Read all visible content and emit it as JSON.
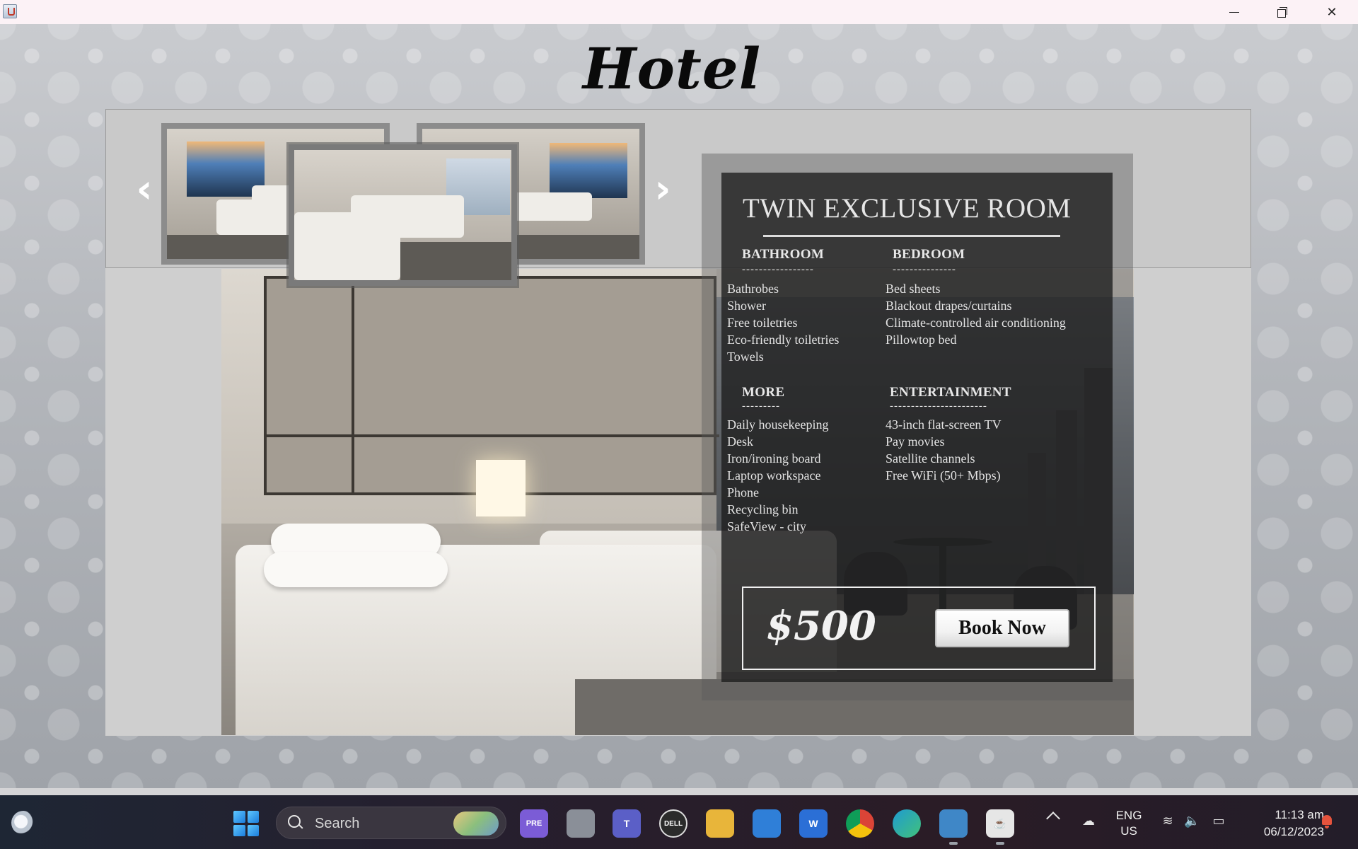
{
  "window": {
    "controls": {
      "minimize": "minimize",
      "maximize": "restore",
      "close": "close"
    }
  },
  "app": {
    "title": "Hotel"
  },
  "gallery": {
    "prev_icon": "chevron-left-icon",
    "next_icon": "chevron-right-icon",
    "prev_glyph": "‹",
    "next_glyph": "›"
  },
  "room": {
    "name": "TWIN EXCLUSIVE ROOM",
    "sections": {
      "bathroom": {
        "heading": "BATHROOM",
        "underline": "-----------------",
        "items": [
          "Bathrobes",
          "Shower",
          "Free toiletries",
          "Eco-friendly toiletries",
          "Towels"
        ]
      },
      "bedroom": {
        "heading": "BEDROOM",
        "underline": "---------------",
        "items": [
          "Bed sheets",
          "Blackout drapes/curtains",
          "Climate-controlled air conditioning",
          "Pillowtop bed"
        ]
      },
      "more": {
        "heading": "MORE",
        "underline": "---------",
        "items": [
          "Daily housekeeping",
          "Desk",
          "Iron/ironing board",
          "Laptop workspace",
          "Phone",
          "Recycling bin",
          "SafeView - city"
        ]
      },
      "entertainment": {
        "heading": "ENTERTAINMENT",
        "underline": "-----------------------",
        "items": [
          "43-inch flat-screen TV",
          "Pay movies",
          "Satellite channels",
          "Free WiFi (50+ Mbps)"
        ]
      }
    },
    "price": "$500",
    "book_label": "Book Now"
  },
  "taskbar": {
    "search_label": "Search",
    "apps": [
      {
        "name": "copilot-icon",
        "label": "PRE",
        "color": "#7b5cd6"
      },
      {
        "name": "task-view-icon",
        "label": "",
        "color": "#8a8f98"
      },
      {
        "name": "teams-icon",
        "label": "T",
        "color": "#5b5fc7"
      },
      {
        "name": "dell-icon",
        "label": "DELL",
        "color": "#2b2b2b"
      },
      {
        "name": "file-explorer-icon",
        "label": "",
        "color": "#e8b53a"
      },
      {
        "name": "microsoft-store-icon",
        "label": "",
        "color": "#2f7fd8"
      },
      {
        "name": "word-icon",
        "label": "W",
        "color": "#2b6fd6"
      },
      {
        "name": "chrome-icon",
        "label": "",
        "color": "#db4437"
      },
      {
        "name": "edge-icon",
        "label": "",
        "color": "#1f9bd1"
      },
      {
        "name": "netbeans-icon",
        "label": "",
        "color": "#3f87c7"
      },
      {
        "name": "java-icon",
        "label": "",
        "color": "#e6e6e6"
      }
    ],
    "language": "ENG",
    "region": "US",
    "time": "11:13 am",
    "date": "06/12/2023"
  }
}
